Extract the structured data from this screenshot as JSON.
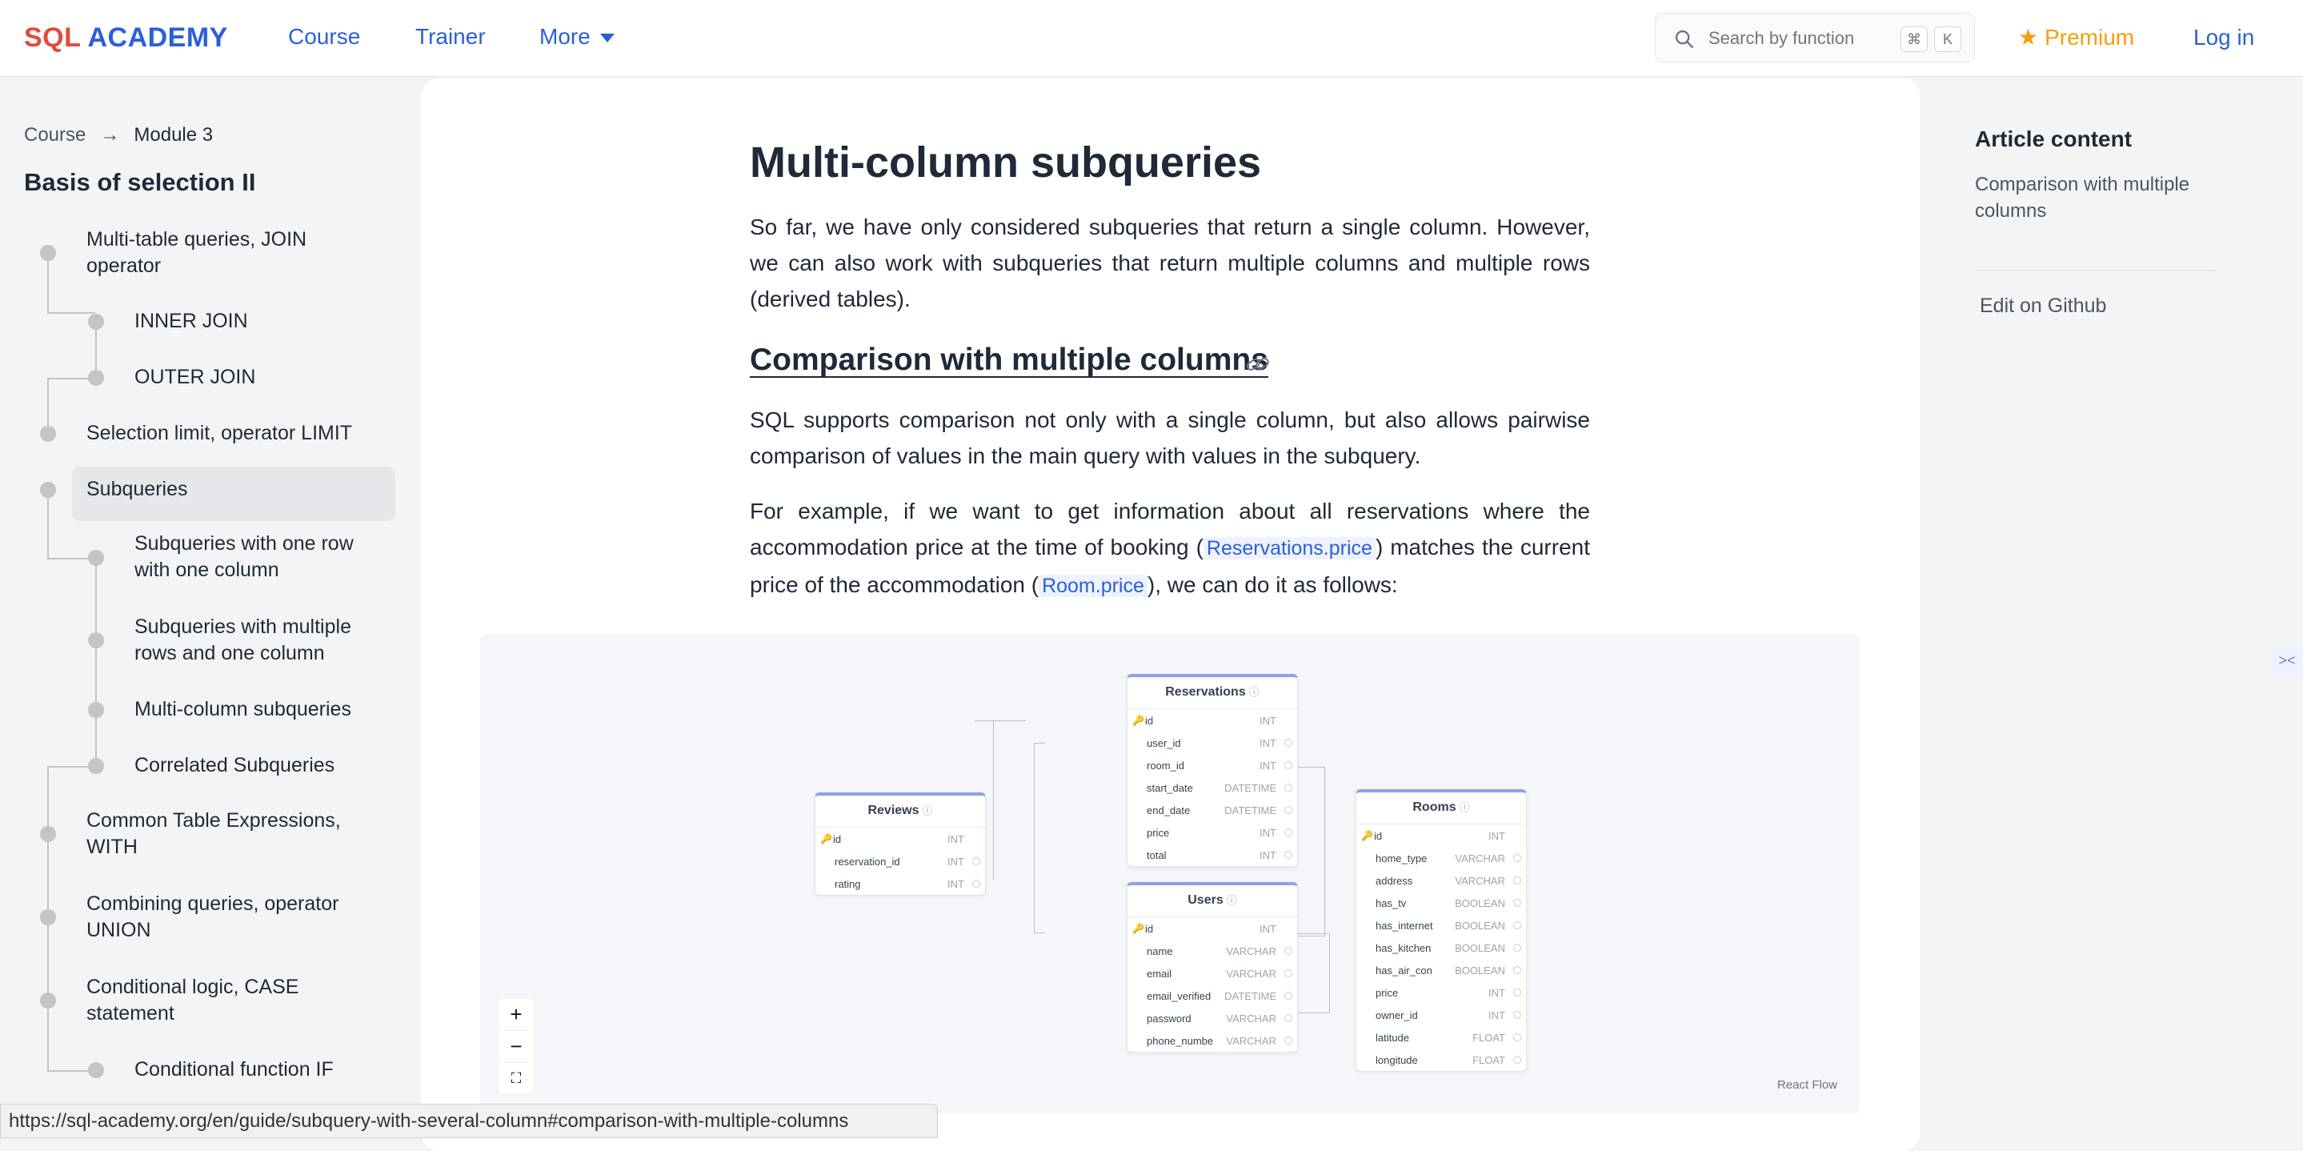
{
  "header": {
    "logo_part1": "SQL",
    "logo_part2": "ACADEMY",
    "nav": {
      "course": "Course",
      "trainer": "Trainer",
      "more": "More"
    },
    "search": {
      "placeholder": "Search by function",
      "kbd1": "⌘",
      "kbd2": "K"
    },
    "premium": "Premium",
    "login": "Log in"
  },
  "sidebar": {
    "breadcrumb": {
      "root": "Course",
      "arrow": "→",
      "current": "Module 3"
    },
    "module_title": "Basis of selection II",
    "items": [
      {
        "label": "Multi-table queries, JOIN operator"
      },
      {
        "label": "INNER JOIN"
      },
      {
        "label": "OUTER JOIN"
      },
      {
        "label": "Selection limit, operator LIMIT"
      },
      {
        "label": "Subqueries"
      },
      {
        "label": "Subqueries with one row with one column"
      },
      {
        "label": "Subqueries with multiple rows and one column"
      },
      {
        "label": "Multi-column subqueries"
      },
      {
        "label": "Correlated Subqueries"
      },
      {
        "label": "Common Table Expressions, WITH"
      },
      {
        "label": "Combining queries, operator UNION"
      },
      {
        "label": "Conditional logic, CASE statement"
      },
      {
        "label": "Conditional function IF"
      }
    ]
  },
  "article": {
    "title": "Multi-column subqueries",
    "intro": "So far, we have only considered subqueries that return a single column. However, we can also work with subqueries that return multiple columns and multiple rows (derived tables).",
    "section_title": "Comparison with multiple columns",
    "p1": "SQL supports comparison not only with a single column, but also allows pairwise comparison of values in the main query with values in the subquery.",
    "p2_a": "For example, if we want to get information about all reservations where the accommodation price at the time of booking (",
    "p2_code1": "Reservations.price",
    "p2_b": ") matches the current price of the accommodation (",
    "p2_code2": "Room.price",
    "p2_c": "), we can do it as follows:"
  },
  "diagram": {
    "reviews": {
      "name": "Reviews",
      "rows": [
        {
          "name": "id",
          "type": "INT"
        },
        {
          "name": "reservation_id",
          "type": "INT"
        },
        {
          "name": "rating",
          "type": "INT"
        }
      ]
    },
    "reservations": {
      "name": "Reservations",
      "rows": [
        {
          "name": "id",
          "type": "INT"
        },
        {
          "name": "user_id",
          "type": "INT"
        },
        {
          "name": "room_id",
          "type": "INT"
        },
        {
          "name": "start_date",
          "type": "DATETIME"
        },
        {
          "name": "end_date",
          "type": "DATETIME"
        },
        {
          "name": "price",
          "type": "INT"
        },
        {
          "name": "total",
          "type": "INT"
        }
      ]
    },
    "users": {
      "name": "Users",
      "rows": [
        {
          "name": "id",
          "type": "INT"
        },
        {
          "name": "name",
          "type": "VARCHAR"
        },
        {
          "name": "email",
          "type": "VARCHAR"
        },
        {
          "name": "email_verified",
          "type": "DATETIME"
        },
        {
          "name": "password",
          "type": "VARCHAR"
        },
        {
          "name": "phone_number",
          "type": "VARCHAR"
        }
      ]
    },
    "rooms": {
      "name": "Rooms",
      "rows": [
        {
          "name": "id",
          "type": "INT"
        },
        {
          "name": "home_type",
          "type": "VARCHAR"
        },
        {
          "name": "address",
          "type": "VARCHAR"
        },
        {
          "name": "has_tv",
          "type": "BOOLEAN"
        },
        {
          "name": "has_internet",
          "type": "BOOLEAN"
        },
        {
          "name": "has_kitchen",
          "type": "BOOLEAN"
        },
        {
          "name": "has_air_con",
          "type": "BOOLEAN"
        },
        {
          "name": "price",
          "type": "INT"
        },
        {
          "name": "owner_id",
          "type": "INT"
        },
        {
          "name": "latitude",
          "type": "FLOAT"
        },
        {
          "name": "longitude",
          "type": "FLOAT"
        }
      ]
    },
    "controls": {
      "zoom_in": "+",
      "zoom_out": "−",
      "fit": "⛶"
    },
    "attribution": "React Flow"
  },
  "toc": {
    "title": "Article content",
    "item": "Comparison with multiple columns",
    "edit": "Edit on Github"
  },
  "statusbar": "https://sql-academy.org/en/guide/subquery-with-several-column#comparison-with-multiple-columns"
}
